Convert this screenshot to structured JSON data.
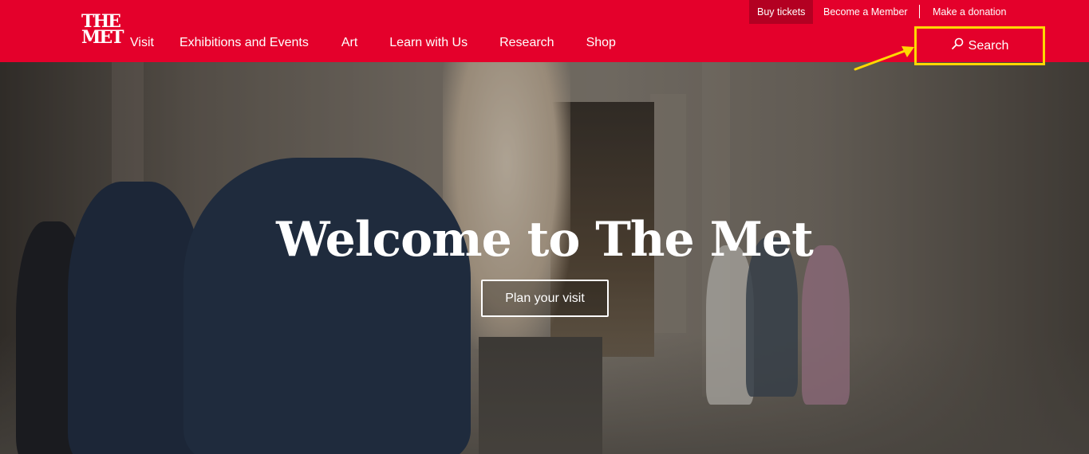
{
  "header": {
    "logo_line1": "THE",
    "logo_line2": "MET",
    "nav": [
      "Visit",
      "Exhibitions and Events",
      "Art",
      "Learn with Us",
      "Research",
      "Shop"
    ],
    "utility": {
      "buy_tickets": "Buy tickets",
      "become_member": "Become a Member",
      "donate": "Make a donation"
    },
    "search_label": "Search"
  },
  "hero": {
    "title": "Welcome to The Met",
    "cta_label": "Plan your visit"
  },
  "colors": {
    "brand_red": "#e4002b",
    "highlight": "#ffd800"
  }
}
